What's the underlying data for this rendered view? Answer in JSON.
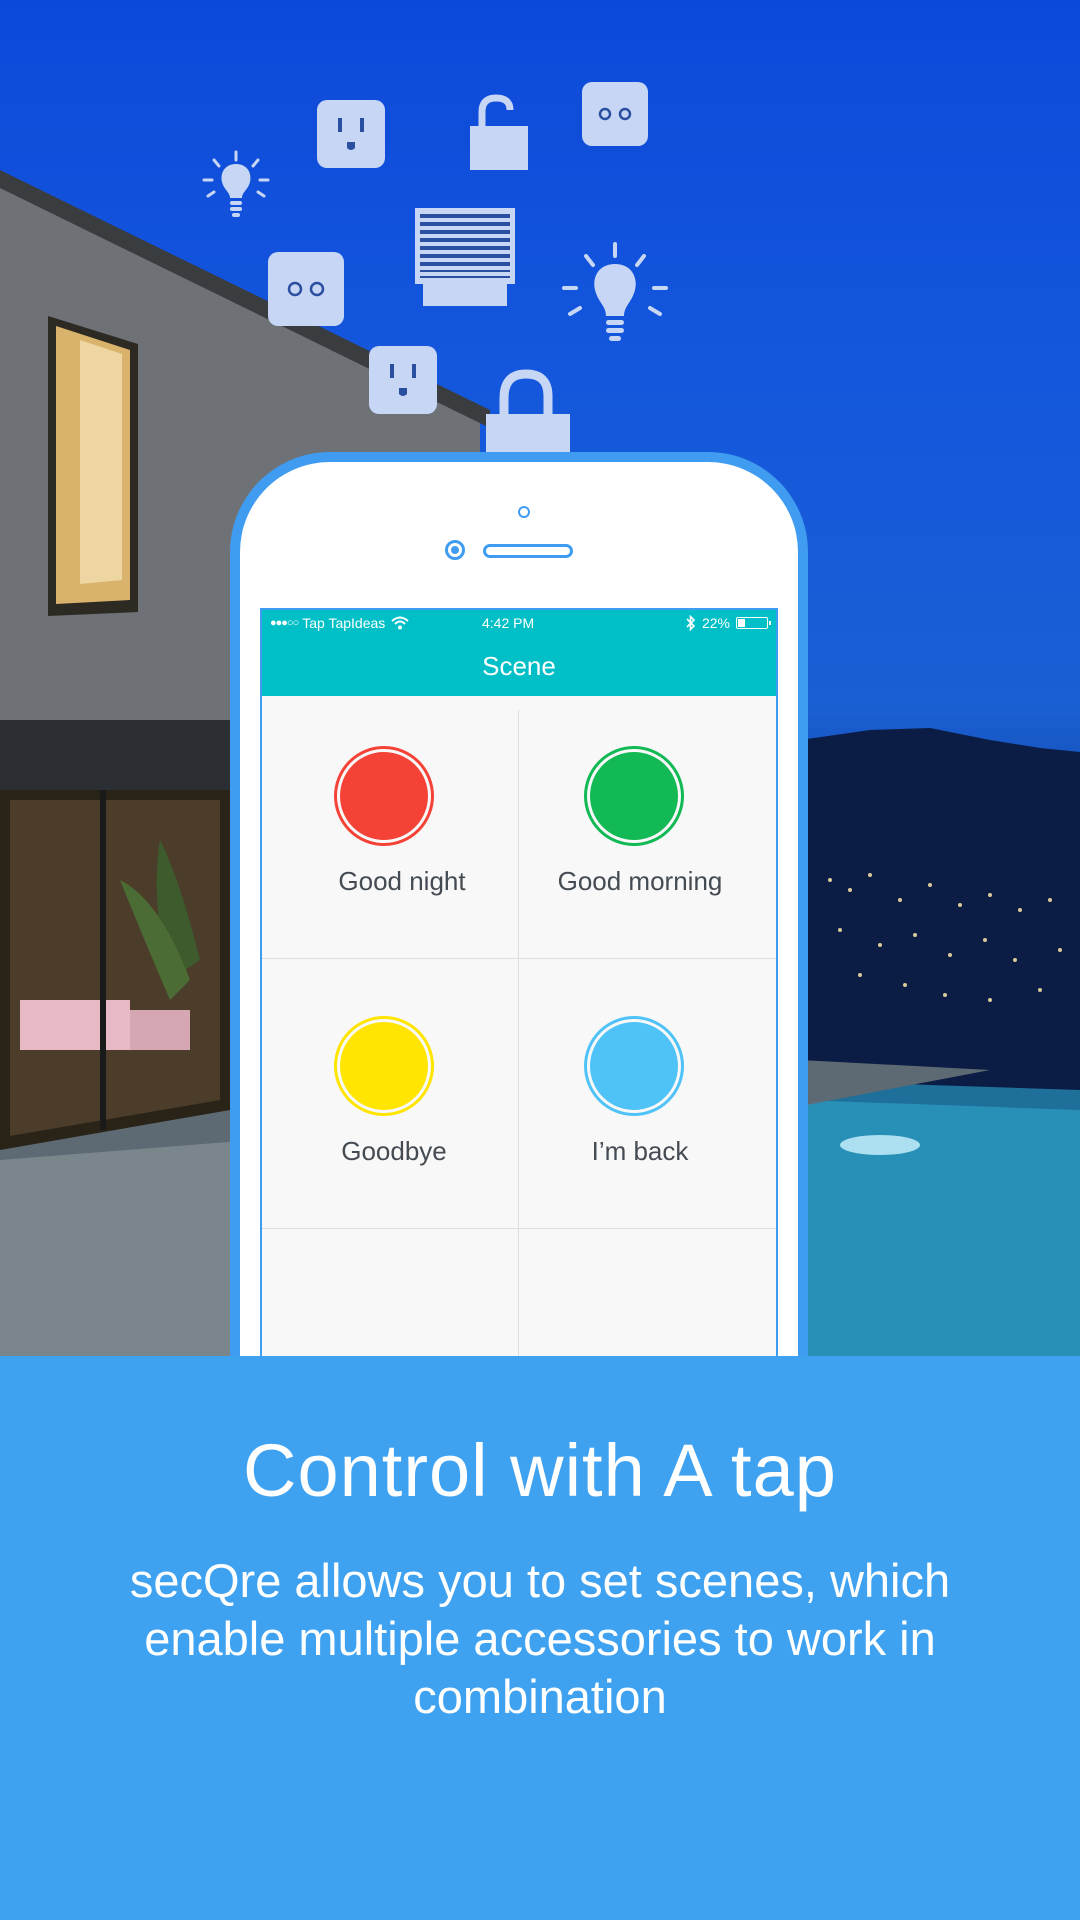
{
  "phone_status_bar": {
    "signal": "●●●○○",
    "carrier": "Tap TapIdeas",
    "wifi_icon": "wifi-icon",
    "time": "4:42 PM",
    "bluetooth_icon": "bluetooth-icon",
    "battery": "22%"
  },
  "app": {
    "title": "Scene",
    "scenes": [
      {
        "label": "Good night",
        "color": "#f44336"
      },
      {
        "label": "Good morning",
        "color": "#12b954"
      },
      {
        "label": "Goodbye",
        "color": "#ffe500"
      },
      {
        "label": "I’m back",
        "color": "#4fc3f7"
      }
    ]
  },
  "floating_icons": [
    "bulb-icon",
    "outlet-icon",
    "lock-icon",
    "switch-icon",
    "blinds-icon",
    "outlet-icon",
    "bulb-icon",
    "outlet-icon",
    "lock-icon",
    "switch-icon"
  ],
  "colors": {
    "accent": "#00bfc6",
    "phone_frame": "#3f9cf0",
    "panel": "#3fa2f1"
  },
  "marketing": {
    "headline": "Control with A tap",
    "description": "secQre allows you to set scenes, which enable multiple accessories to work in combination"
  }
}
